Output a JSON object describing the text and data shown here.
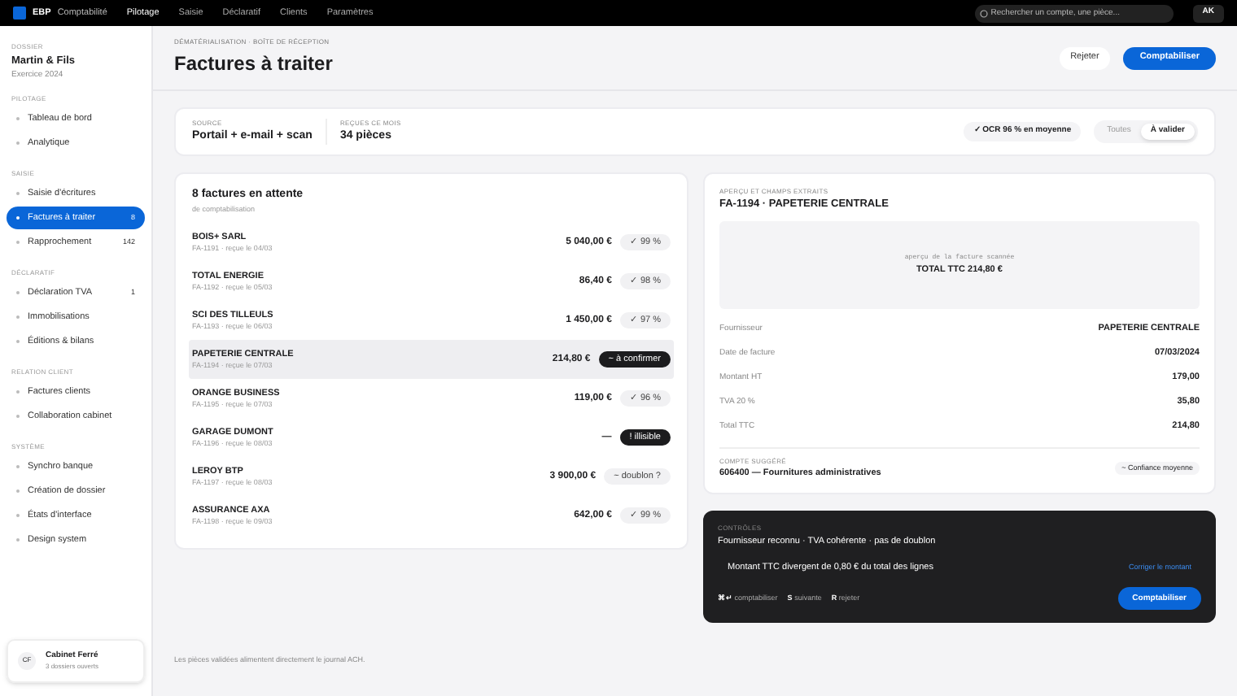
{
  "topbar": {
    "logo": "EBP",
    "product": "Comptabilité",
    "menu": [
      {
        "label": "Pilotage",
        "selected": true
      },
      {
        "label": "Saisie",
        "selected": false
      },
      {
        "label": "Déclaratif",
        "selected": false
      },
      {
        "label": "Clients",
        "selected": false
      },
      {
        "label": "Paramètres",
        "selected": false
      }
    ],
    "search": {
      "placeholder": "Rechercher un compte, une pièce..."
    },
    "avatar": "AK"
  },
  "sidebar": {
    "folder_label": "DOSSIER",
    "folder": "Martin & Fils",
    "year": "Exercice 2024",
    "sections": [
      {
        "title": "PILOTAGE",
        "items": [
          {
            "label": "Tableau de bord",
            "selected": false
          },
          {
            "label": "Analytique",
            "selected": false
          }
        ]
      },
      {
        "title": "SAISIE",
        "items": [
          {
            "label": "Saisie d'écritures",
            "selected": false
          },
          {
            "label": "Factures à traiter",
            "selected": true,
            "count": "8"
          },
          {
            "label": "Rapprochement",
            "selected": false,
            "count": "142"
          }
        ]
      },
      {
        "title": "DÉCLARATIF",
        "items": [
          {
            "label": "Déclaration TVA",
            "selected": false,
            "count": "1"
          },
          {
            "label": "Immobilisations",
            "selected": false
          },
          {
            "label": "Éditions & bilans",
            "selected": false
          }
        ]
      },
      {
        "title": "RELATION CLIENT",
        "items": [
          {
            "label": "Factures clients",
            "selected": false
          },
          {
            "label": "Collaboration cabinet",
            "selected": false
          }
        ]
      },
      {
        "title": "SYSTÈME",
        "items": [
          {
            "label": "Synchro banque",
            "selected": false
          },
          {
            "label": "Création de dossier",
            "selected": false
          },
          {
            "label": "États d'interface",
            "selected": false
          },
          {
            "label": "Design system",
            "selected": false
          }
        ]
      }
    ],
    "account": {
      "initials": "CF",
      "name": "Cabinet Ferré",
      "detail": "3 dossiers ouverts"
    }
  },
  "header": {
    "breadcrumb": "DÉMATÉRIALISATION · BOÎTE DE RÉCEPTION",
    "title": "Factures à traiter",
    "buttons": [
      {
        "label": "Rejeter",
        "kind": "secondary"
      },
      {
        "label": "Comptabiliser",
        "kind": "primary"
      }
    ]
  },
  "summary": {
    "stats": [
      {
        "label": "SOURCE",
        "value": "Portail + e-mail + scan"
      },
      {
        "label": "REÇUES CE MOIS",
        "value": "34 pièces"
      }
    ],
    "ocr": "✓ OCR 96 % en moyenne",
    "filters": [
      {
        "label": "Toutes",
        "selected": false
      },
      {
        "label": "À valider",
        "selected": true
      }
    ]
  },
  "invoices": {
    "title": "8 factures en attente",
    "subtitle": "de comptabilisation",
    "rows": [
      {
        "name": "BOIS+ SARL",
        "meta": "FA-1191 · reçue le 04/03",
        "amount": "5 040,00 €",
        "badge": "✓ 99 %",
        "kind": "light",
        "selected": false
      },
      {
        "name": "TOTAL ENERGIE",
        "meta": "FA-1192 · reçue le 05/03",
        "amount": "86,40 €",
        "badge": "✓ 98 %",
        "kind": "light",
        "selected": false
      },
      {
        "name": "SCI DES TILLEULS",
        "meta": "FA-1193 · reçue le 06/03",
        "amount": "1 450,00 €",
        "badge": "✓ 97 %",
        "kind": "light",
        "selected": false
      },
      {
        "name": "PAPETERIE CENTRALE",
        "meta": "FA-1194 · reçue le 07/03",
        "amount": "214,80 €",
        "badge": "~ à confirmer",
        "kind": "dark",
        "selected": true
      },
      {
        "name": "ORANGE BUSINESS",
        "meta": "FA-1195 · reçue le 07/03",
        "amount": "119,00 €",
        "badge": "✓ 96 %",
        "kind": "light",
        "selected": false
      },
      {
        "name": "GARAGE DUMONT",
        "meta": "FA-1196 · reçue le 08/03",
        "amount": "—",
        "badge": "! illisible",
        "kind": "dark",
        "selected": false
      },
      {
        "name": "LEROY BTP",
        "meta": "FA-1197 · reçue le 08/03",
        "amount": "3 900,00 €",
        "badge": "~ doublon ?",
        "kind": "light",
        "selected": false
      },
      {
        "name": "ASSURANCE AXA",
        "meta": "FA-1198 · reçue le 09/03",
        "amount": "642,00 €",
        "badge": "✓ 99 %",
        "kind": "light",
        "selected": false
      }
    ]
  },
  "detail": {
    "label": "APERÇU ET CHAMPS EXTRAITS",
    "title": "FA-1194 · PAPETERIE CENTRALE",
    "preview_caption": "aperçu de la facture scannée",
    "preview_total": "TOTAL TTC 214,80 €",
    "fields": [
      {
        "label": "Fournisseur",
        "value": "PAPETERIE CENTRALE"
      },
      {
        "label": "Date de facture",
        "value": "07/03/2024"
      },
      {
        "label": "Montant HT",
        "value": "179,00"
      },
      {
        "label": "TVA 20 %",
        "value": "35,80"
      },
      {
        "label": "Total TTC",
        "value": "214,80"
      }
    ],
    "account_label": "COMPTE SUGGÉRÉ",
    "account": "606400 — Fournitures administratives",
    "confidence": "~ Confiance moyenne"
  },
  "controls": {
    "label": "CONTRÔLES",
    "summary": "Fournisseur reconnu · TVA cohérente · pas de doublon",
    "warning": "Montant TTC divergent de 0,80 € du total des lignes",
    "fix_link": "Corriger le montant",
    "shortcuts": [
      {
        "key": "⌘↵",
        "label": "comptabiliser"
      },
      {
        "key": "S",
        "label": "suivante"
      },
      {
        "key": "R",
        "label": "rejeter"
      }
    ],
    "button": "Comptabiliser"
  },
  "footer": "Les pièces validées alimentent directement le journal ACH."
}
